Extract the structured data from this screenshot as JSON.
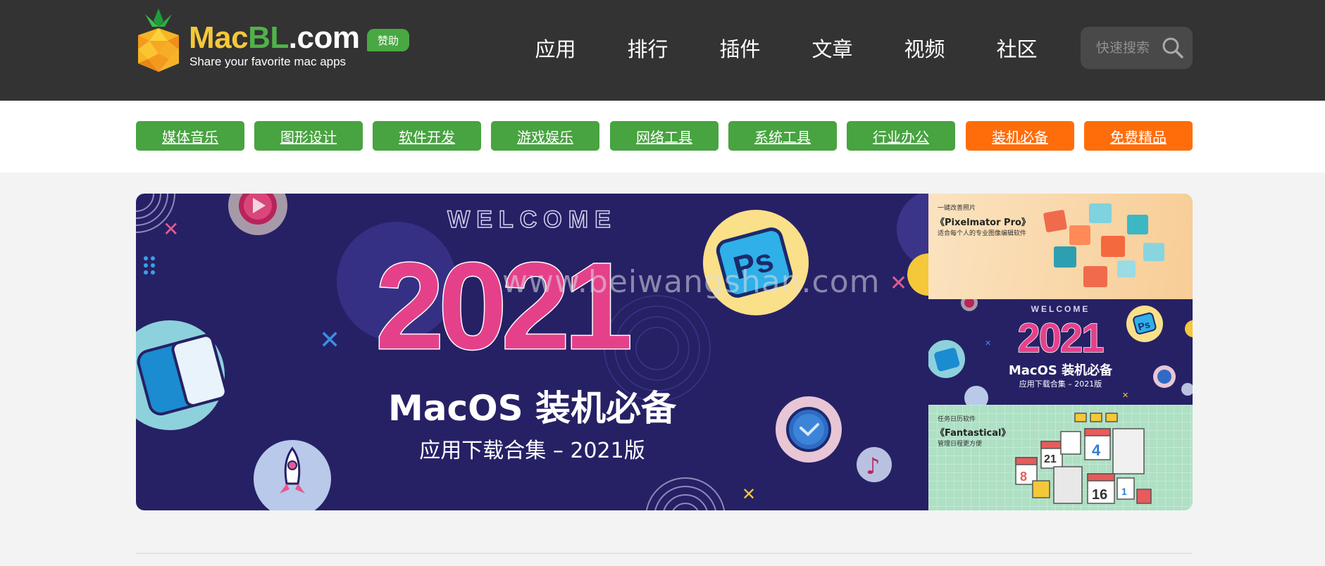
{
  "header": {
    "logo": {
      "part1": "Mac",
      "part2": "BL",
      "part3": ".com",
      "tagline": "Share your favorite mac apps"
    },
    "sponsor_label": "赞助",
    "nav": [
      {
        "label": "应用"
      },
      {
        "label": "排行"
      },
      {
        "label": "插件"
      },
      {
        "label": "文章"
      },
      {
        "label": "视频"
      },
      {
        "label": "社区"
      }
    ],
    "search": {
      "placeholder": "快速搜索",
      "icon": "search-icon"
    }
  },
  "categories": [
    {
      "label": "媒体音乐",
      "color": "#48a341"
    },
    {
      "label": "图形设计",
      "color": "#48a341"
    },
    {
      "label": "软件开发",
      "color": "#48a341"
    },
    {
      "label": "游戏娱乐",
      "color": "#48a341"
    },
    {
      "label": "网络工具",
      "color": "#48a341"
    },
    {
      "label": "系统工具",
      "color": "#48a341"
    },
    {
      "label": "行业办公",
      "color": "#48a341"
    },
    {
      "label": "装机必备",
      "color": "#ff6d0a"
    },
    {
      "label": "免费精品",
      "color": "#ff6d0a"
    }
  ],
  "banner_main": {
    "welcome": "WELCOME",
    "year": "2021",
    "title": "MacOS 装机必备",
    "subtitle": "应用下载合集 – 2021版",
    "watermark": "www.beiwangshan.com",
    "icons": [
      "photoshop-icon",
      "finder-icon",
      "rocket-icon",
      "clock-icon",
      "music-note-icon",
      "play-icon"
    ]
  },
  "side_banners": [
    {
      "kicker": "一键改善照片",
      "title": "《Pixelmator Pro》",
      "desc": "适合每个人的专业图像编辑软件"
    },
    {
      "welcome": "WELCOME",
      "year": "2021",
      "title": "MacOS 装机必备",
      "subtitle": "应用下载合集 – 2021版"
    },
    {
      "kicker": "任务日历软件",
      "title": "《Fantastical》",
      "desc": "管理日程更方便"
    }
  ],
  "colors": {
    "header_bg": "#333333",
    "green": "#48a341",
    "orange": "#ff6d0a",
    "banner_navy": "#262165",
    "brand_yellow": "#f5c83a"
  }
}
